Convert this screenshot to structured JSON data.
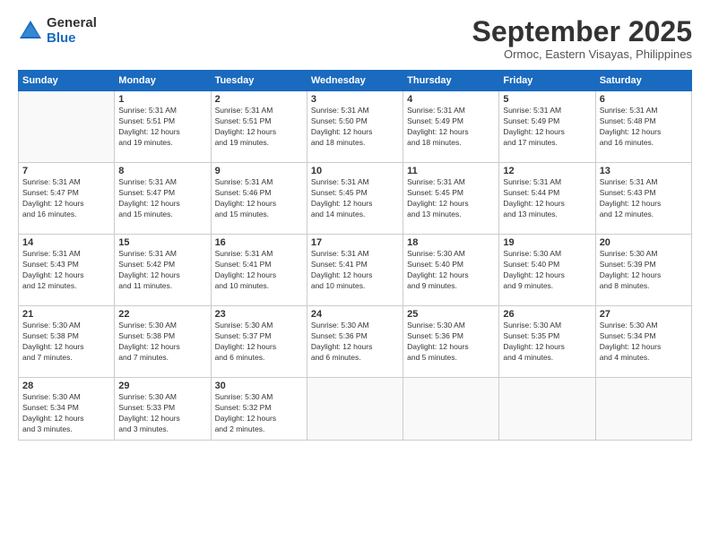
{
  "logo": {
    "general": "General",
    "blue": "Blue"
  },
  "header": {
    "month": "September 2025",
    "location": "Ormoc, Eastern Visayas, Philippines"
  },
  "weekdays": [
    "Sunday",
    "Monday",
    "Tuesday",
    "Wednesday",
    "Thursday",
    "Friday",
    "Saturday"
  ],
  "weeks": [
    [
      {
        "day": "",
        "info": ""
      },
      {
        "day": "1",
        "info": "Sunrise: 5:31 AM\nSunset: 5:51 PM\nDaylight: 12 hours\nand 19 minutes."
      },
      {
        "day": "2",
        "info": "Sunrise: 5:31 AM\nSunset: 5:51 PM\nDaylight: 12 hours\nand 19 minutes."
      },
      {
        "day": "3",
        "info": "Sunrise: 5:31 AM\nSunset: 5:50 PM\nDaylight: 12 hours\nand 18 minutes."
      },
      {
        "day": "4",
        "info": "Sunrise: 5:31 AM\nSunset: 5:49 PM\nDaylight: 12 hours\nand 18 minutes."
      },
      {
        "day": "5",
        "info": "Sunrise: 5:31 AM\nSunset: 5:49 PM\nDaylight: 12 hours\nand 17 minutes."
      },
      {
        "day": "6",
        "info": "Sunrise: 5:31 AM\nSunset: 5:48 PM\nDaylight: 12 hours\nand 16 minutes."
      }
    ],
    [
      {
        "day": "7",
        "info": "Sunrise: 5:31 AM\nSunset: 5:47 PM\nDaylight: 12 hours\nand 16 minutes."
      },
      {
        "day": "8",
        "info": "Sunrise: 5:31 AM\nSunset: 5:47 PM\nDaylight: 12 hours\nand 15 minutes."
      },
      {
        "day": "9",
        "info": "Sunrise: 5:31 AM\nSunset: 5:46 PM\nDaylight: 12 hours\nand 15 minutes."
      },
      {
        "day": "10",
        "info": "Sunrise: 5:31 AM\nSunset: 5:45 PM\nDaylight: 12 hours\nand 14 minutes."
      },
      {
        "day": "11",
        "info": "Sunrise: 5:31 AM\nSunset: 5:45 PM\nDaylight: 12 hours\nand 13 minutes."
      },
      {
        "day": "12",
        "info": "Sunrise: 5:31 AM\nSunset: 5:44 PM\nDaylight: 12 hours\nand 13 minutes."
      },
      {
        "day": "13",
        "info": "Sunrise: 5:31 AM\nSunset: 5:43 PM\nDaylight: 12 hours\nand 12 minutes."
      }
    ],
    [
      {
        "day": "14",
        "info": "Sunrise: 5:31 AM\nSunset: 5:43 PM\nDaylight: 12 hours\nand 12 minutes."
      },
      {
        "day": "15",
        "info": "Sunrise: 5:31 AM\nSunset: 5:42 PM\nDaylight: 12 hours\nand 11 minutes."
      },
      {
        "day": "16",
        "info": "Sunrise: 5:31 AM\nSunset: 5:41 PM\nDaylight: 12 hours\nand 10 minutes."
      },
      {
        "day": "17",
        "info": "Sunrise: 5:31 AM\nSunset: 5:41 PM\nDaylight: 12 hours\nand 10 minutes."
      },
      {
        "day": "18",
        "info": "Sunrise: 5:30 AM\nSunset: 5:40 PM\nDaylight: 12 hours\nand 9 minutes."
      },
      {
        "day": "19",
        "info": "Sunrise: 5:30 AM\nSunset: 5:40 PM\nDaylight: 12 hours\nand 9 minutes."
      },
      {
        "day": "20",
        "info": "Sunrise: 5:30 AM\nSunset: 5:39 PM\nDaylight: 12 hours\nand 8 minutes."
      }
    ],
    [
      {
        "day": "21",
        "info": "Sunrise: 5:30 AM\nSunset: 5:38 PM\nDaylight: 12 hours\nand 7 minutes."
      },
      {
        "day": "22",
        "info": "Sunrise: 5:30 AM\nSunset: 5:38 PM\nDaylight: 12 hours\nand 7 minutes."
      },
      {
        "day": "23",
        "info": "Sunrise: 5:30 AM\nSunset: 5:37 PM\nDaylight: 12 hours\nand 6 minutes."
      },
      {
        "day": "24",
        "info": "Sunrise: 5:30 AM\nSunset: 5:36 PM\nDaylight: 12 hours\nand 6 minutes."
      },
      {
        "day": "25",
        "info": "Sunrise: 5:30 AM\nSunset: 5:36 PM\nDaylight: 12 hours\nand 5 minutes."
      },
      {
        "day": "26",
        "info": "Sunrise: 5:30 AM\nSunset: 5:35 PM\nDaylight: 12 hours\nand 4 minutes."
      },
      {
        "day": "27",
        "info": "Sunrise: 5:30 AM\nSunset: 5:34 PM\nDaylight: 12 hours\nand 4 minutes."
      }
    ],
    [
      {
        "day": "28",
        "info": "Sunrise: 5:30 AM\nSunset: 5:34 PM\nDaylight: 12 hours\nand 3 minutes."
      },
      {
        "day": "29",
        "info": "Sunrise: 5:30 AM\nSunset: 5:33 PM\nDaylight: 12 hours\nand 3 minutes."
      },
      {
        "day": "30",
        "info": "Sunrise: 5:30 AM\nSunset: 5:32 PM\nDaylight: 12 hours\nand 2 minutes."
      },
      {
        "day": "",
        "info": ""
      },
      {
        "day": "",
        "info": ""
      },
      {
        "day": "",
        "info": ""
      },
      {
        "day": "",
        "info": ""
      }
    ]
  ]
}
